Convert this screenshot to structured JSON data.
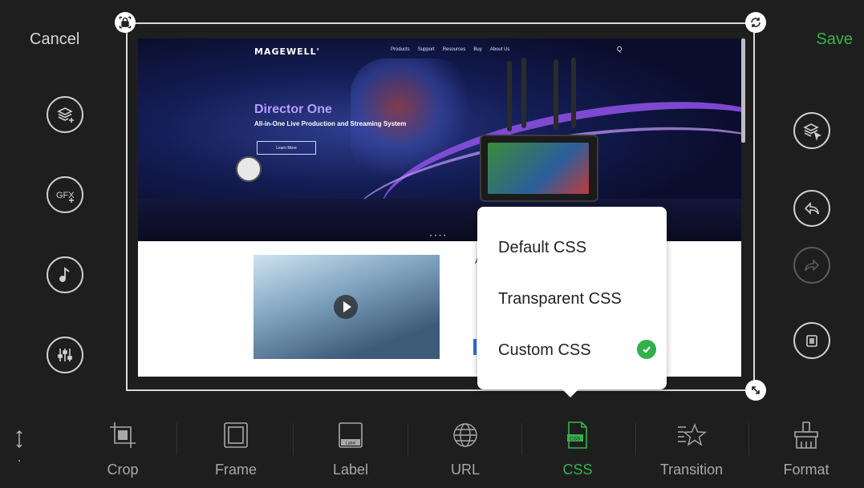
{
  "topbar": {
    "cancel_label": "Cancel",
    "save_label": "Save"
  },
  "accent_color": "#37b24d",
  "left_buttons": [
    {
      "icon": "add-layer-icon"
    },
    {
      "icon": "add-gfx-icon",
      "text": "GFX"
    },
    {
      "icon": "music-icon"
    },
    {
      "icon": "mixer-icon"
    }
  ],
  "right_buttons": [
    {
      "icon": "select-layer-icon"
    },
    {
      "icon": "undo-icon"
    },
    {
      "icon": "redo-icon",
      "disabled": true
    },
    {
      "icon": "trash-icon"
    }
  ],
  "webpage": {
    "brand": "MAGEWELL'",
    "nav": [
      "Products",
      "Support",
      "Resources",
      "Buy",
      "About Us"
    ],
    "search_glyph": "Q",
    "hero_title": "Director One",
    "hero_subtitle": "All-in-One Live Production and Streaming System",
    "hero_button": "Learn More",
    "side_text": "A"
  },
  "css_menu": {
    "options": [
      "Default CSS",
      "Transparent CSS",
      "Custom CSS"
    ],
    "selected": "Custom CSS"
  },
  "toolbar": {
    "items": [
      {
        "label": "Crop",
        "icon": "crop-icon"
      },
      {
        "label": "Frame",
        "icon": "frame-icon"
      },
      {
        "label": "Label",
        "icon": "label-icon",
        "icon_text": "Label"
      },
      {
        "label": "URL",
        "icon": "globe-icon"
      },
      {
        "label": "CSS",
        "icon": "css-icon",
        "icon_text": "CSS",
        "active": true
      },
      {
        "label": "Transition",
        "icon": "transition-icon"
      },
      {
        "label": "Format",
        "icon": "format-icon"
      }
    ]
  }
}
